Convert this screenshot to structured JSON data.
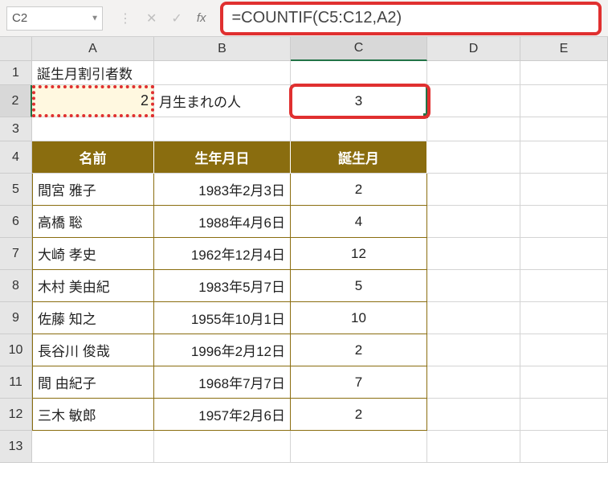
{
  "name_box": "C2",
  "formula": "=COUNTIF(C5:C12,A2)",
  "col_headers": [
    "A",
    "B",
    "C",
    "D",
    "E"
  ],
  "row_headers": [
    "1",
    "2",
    "3",
    "4",
    "5",
    "6",
    "7",
    "8",
    "9",
    "10",
    "11",
    "12",
    "13"
  ],
  "r1": {
    "a": "誕生月割引者数"
  },
  "r2": {
    "a": "2",
    "b": "月生まれの人",
    "c": "3"
  },
  "table_headers": {
    "a": "名前",
    "b": "生年月日",
    "c": "誕生月"
  },
  "rows": [
    {
      "a": "間宮 雅子",
      "b": "1983年2月3日",
      "c": "2"
    },
    {
      "a": "高橋 聡",
      "b": "1988年4月6日",
      "c": "4"
    },
    {
      "a": "大崎 孝史",
      "b": "1962年12月4日",
      "c": "12"
    },
    {
      "a": "木村 美由紀",
      "b": "1983年5月7日",
      "c": "5"
    },
    {
      "a": "佐藤 知之",
      "b": "1955年10月1日",
      "c": "10"
    },
    {
      "a": "長谷川 俊哉",
      "b": "1996年2月12日",
      "c": "2"
    },
    {
      "a": "間 由紀子",
      "b": "1968年7月7日",
      "c": "7"
    },
    {
      "a": "三木 敏郎",
      "b": "1957年2月6日",
      "c": "2"
    }
  ],
  "chart_data": {
    "type": "table",
    "title": "誕生月割引者数",
    "lookup_month": 2,
    "lookup_label": "月生まれの人",
    "result": 3,
    "columns": [
      "名前",
      "生年月日",
      "誕生月"
    ],
    "data": [
      [
        "間宮 雅子",
        "1983年2月3日",
        2
      ],
      [
        "高橋 聡",
        "1988年4月6日",
        4
      ],
      [
        "大崎 孝史",
        "1962年12月4日",
        12
      ],
      [
        "木村 美由紀",
        "1983年5月7日",
        5
      ],
      [
        "佐藤 知之",
        "1955年10月1日",
        10
      ],
      [
        "長谷川 俊哉",
        "1996年2月12日",
        2
      ],
      [
        "間 由紀子",
        "1968年7月7日",
        7
      ],
      [
        "三木 敏郎",
        "1957年2月6日",
        2
      ]
    ]
  }
}
